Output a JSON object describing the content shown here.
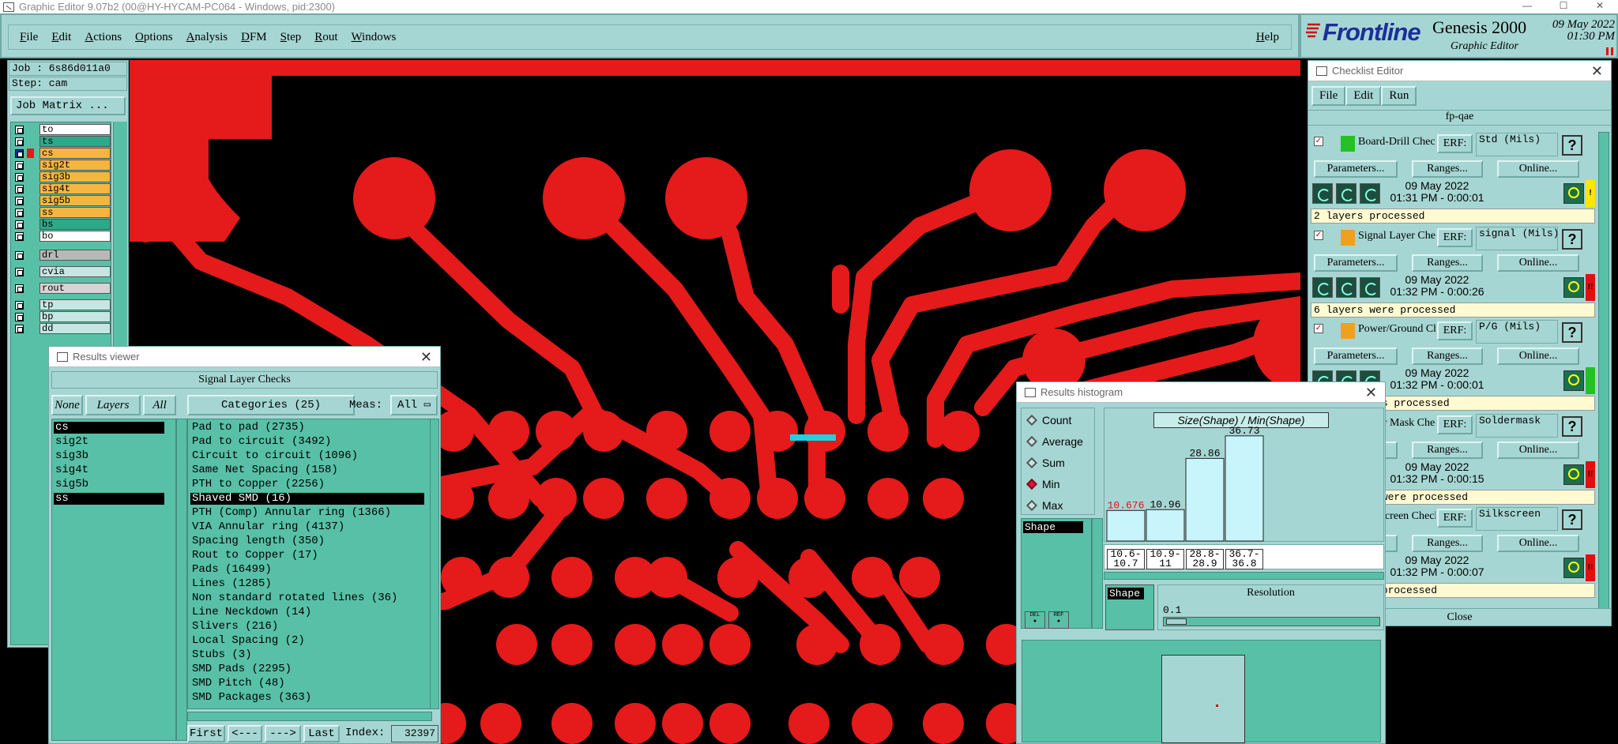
{
  "os_titlebar": {
    "title": "Graphic Editor 9.07b2 (00@HY-HYCAM-PC064 - Windows, pid:2300)"
  },
  "menubar": {
    "items": [
      "File",
      "Edit",
      "Actions",
      "Options",
      "Analysis",
      "DFM",
      "Step",
      "Rout",
      "Windows"
    ],
    "help": "Help"
  },
  "brand": {
    "name": "Frontline",
    "product": "Genesis 2000",
    "subtitle": "Graphic Editor",
    "date": "09 May 2022",
    "time": "01:30 PM"
  },
  "left_panel": {
    "job": "Job : 6s86d011a0",
    "step": "Step: cam",
    "job_matrix_button": "Job Matrix ...",
    "layers": [
      {
        "name": "to",
        "bg": "#ffffff",
        "color": "#ffffff",
        "edit": true
      },
      {
        "name": "ts",
        "bg": "#2ea88a",
        "color": "#2ea88a",
        "edit": false
      },
      {
        "name": "cs",
        "bg": "#f4b640",
        "color": "#e51a1a",
        "edit": true,
        "active": true
      },
      {
        "name": "sig2t",
        "bg": "#f4b640",
        "color": "#f4b640",
        "edit": false
      },
      {
        "name": "sig3b",
        "bg": "#f4b640",
        "color": "#f4b640",
        "edit": false
      },
      {
        "name": "sig4t",
        "bg": "#f4b640",
        "color": "#f4b640",
        "edit": false
      },
      {
        "name": "sig5b",
        "bg": "#f4b640",
        "color": "#f4b640",
        "edit": false
      },
      {
        "name": "ss",
        "bg": "#f4b640",
        "color": "#f4b640",
        "edit": true
      },
      {
        "name": "bs",
        "bg": "#2ea88a",
        "color": "#2ea88a",
        "edit": false
      },
      {
        "name": "bo",
        "bg": "#ffffff",
        "color": "#ffffff",
        "edit": true
      },
      {
        "name": "drl",
        "bg": "#b8b8b8",
        "color": "#b8b8b8",
        "edit": false
      },
      {
        "name": "cvia",
        "bg": "#c6e6e3",
        "color": "#c6e6e3",
        "edit": false
      },
      {
        "name": "rout",
        "bg": "#d4d4d4",
        "color": "#d4d4d4",
        "edit": false
      },
      {
        "name": "tp",
        "bg": "#c6e6e3",
        "color": "#c6e6e3",
        "edit": false
      },
      {
        "name": "bp",
        "bg": "#c6e6e3",
        "color": "#c6e6e3",
        "edit": false
      },
      {
        "name": "dd",
        "bg": "#c6e6e3",
        "color": "#c6e6e3",
        "edit": false
      }
    ]
  },
  "checklist": {
    "title": "Checklist Editor",
    "menu": [
      "File",
      "Edit",
      "Run"
    ],
    "name": "fp-qae",
    "buttons": {
      "params": "Parameters...",
      "ranges": "Ranges...",
      "online": "Online..."
    },
    "close": "Close",
    "checks": [
      {
        "name": "Board-Drill Checks",
        "erf_label": "ERF:",
        "erf": "Std (Mils)",
        "date": "09 May 2022",
        "time": "01:31 PM - 0:00:01",
        "result": "2 layers processed",
        "status_color": "#ffe600",
        "status_glyph": "!",
        "icon_color": "#25c025"
      },
      {
        "name": "Signal Layer Checks",
        "erf_label": "ERF:",
        "erf": "signal (Mils)",
        "date": "09 May 2022",
        "time": "01:32 PM - 0:00:26",
        "result": "6 layers were processed",
        "status_color": "#e01010",
        "status_glyph": "!!",
        "icon_color": "#f0a020"
      },
      {
        "name": "Power/Ground Checks",
        "erf_label": "ERF:",
        "erf": "P/G (Mils)",
        "date": "09 May 2022",
        "time": "01:32 PM - 0:00:01",
        "result": "round layers processed",
        "status_color": "#25c025",
        "status_glyph": "",
        "icon_color": "#f0a020"
      },
      {
        "name": "Solder Mask Checks",
        "erf_label": "ERF:",
        "erf": "Soldermask",
        "date": "09 May 2022",
        "time": "01:32 PM - 0:00:15",
        "result": "ask layers were processed",
        "status_color": "#e01010",
        "status_glyph": "!!",
        "icon_color": "#25c025"
      },
      {
        "name": "Silk Screen Checks",
        "erf_label": "ERF:",
        "erf": "Silkscreen",
        "date": "09 May 2022",
        "time": "01:32 PM - 0:00:07",
        "result": "een layers processed",
        "status_color": "#e01010",
        "status_glyph": "!!",
        "icon_color": "#25c025"
      }
    ]
  },
  "results_viewer": {
    "title": "Results viewer",
    "panel_title": "Signal Layer Checks",
    "btn_none": "None",
    "btn_layers": "Layers",
    "btn_all": "All",
    "categories_label": "Categories (25)",
    "meas_label": "Meas:",
    "meas_value": "All",
    "layers": [
      "cs",
      "sig2t",
      "sig3b",
      "sig4t",
      "sig5b",
      "ss"
    ],
    "categories": [
      "Pad to pad (2735)",
      "Pad to circuit (3492)",
      "Circuit to circuit (1096)",
      "Same Net Spacing (158)",
      "PTH to Copper (2256)",
      "Shaved SMD (16)",
      "PTH (Comp) Annular ring (1366)",
      "VIA Annular ring (4137)",
      "Spacing length (350)",
      "Rout to Copper (17)",
      "Pads (16499)",
      "Lines (1285)",
      "Non standard rotated lines (36)",
      "Line Neckdown (14)",
      "Slivers (216)",
      "Local Spacing (2)",
      "Stubs (3)",
      "SMD Pads (2295)",
      "SMD Pitch (48)",
      "SMD Packages (363)"
    ],
    "selected_category_index": 5,
    "nav": {
      "first": "First",
      "prev": "<---",
      "next": "--->",
      "last": "Last",
      "index_label": "Index:",
      "index": "32397"
    }
  },
  "histogram": {
    "title": "Results histogram",
    "modes": [
      "Count",
      "Average",
      "Sum",
      "Min",
      "Max"
    ],
    "selected_mode": "Min",
    "shape_item": "Shape",
    "shape_box_label": "Shape",
    "chart_title": "Size(Shape) / Min(Shape)",
    "resolution_label": "Resolution",
    "resolution_value": "0.1",
    "icon_buttons": [
      "DEL",
      "REF"
    ]
  },
  "chart_data": {
    "type": "bar",
    "title": "Size(Shape) / Min(Shape)",
    "categories": [
      "10.6-10.7",
      "10.9-11",
      "28.8-28.9",
      "36.7-36.8"
    ],
    "values": [
      10.676,
      10.96,
      28.86,
      36.73
    ],
    "value_labels": [
      "10.676",
      "10.96",
      "28.86",
      "36.73"
    ],
    "highlight_color": "#e01010"
  }
}
